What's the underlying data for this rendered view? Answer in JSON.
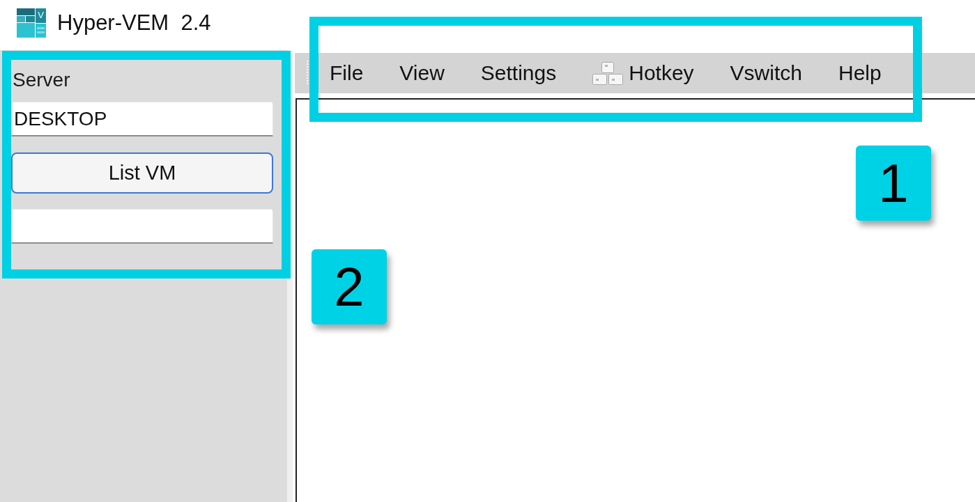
{
  "window": {
    "title": "Hyper-VEM  2.4",
    "logo_letter": "V"
  },
  "sidebar": {
    "controls": [
      {
        "kind": "label",
        "text": "Server"
      },
      {
        "kind": "field",
        "value": "DESKTOP"
      },
      {
        "kind": "button",
        "label": "List VM",
        "focused": true
      },
      {
        "kind": "field"
      }
    ]
  },
  "menu": {
    "items": [
      {
        "label": "File",
        "has_icon": false
      },
      {
        "label": "View",
        "has_icon": false
      },
      {
        "label": "Settings",
        "has_icon": false
      },
      {
        "label": "Hotkey",
        "has_icon": true
      },
      {
        "label": "Vswitch",
        "has_icon": false
      },
      {
        "label": "Help",
        "has_icon": false
      }
    ]
  },
  "callouts": [
    {
      "kind": "menu",
      "label": "1"
    },
    {
      "kind": "sidebar",
      "label": "2"
    }
  ]
}
